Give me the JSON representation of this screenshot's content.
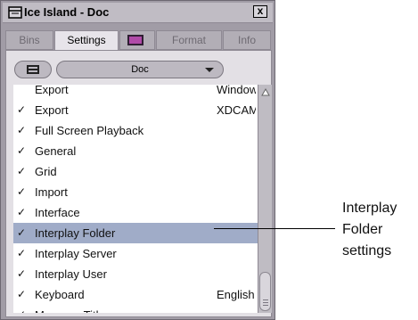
{
  "window": {
    "title": "Ice Island - Doc",
    "close_glyph": "x"
  },
  "tabs": [
    {
      "label": "Bins"
    },
    {
      "label": "Settings"
    },
    {
      "label": ""
    },
    {
      "label": "Format"
    },
    {
      "label": "Info"
    }
  ],
  "toolbar": {
    "selector_value": "Doc"
  },
  "settings_list": [
    {
      "check": "",
      "name": "Export",
      "value": "Window"
    },
    {
      "check": "✓",
      "name": "Export",
      "value": "XDCAM"
    },
    {
      "check": "✓",
      "name": "Full Screen Playback",
      "value": ""
    },
    {
      "check": "✓",
      "name": "General",
      "value": ""
    },
    {
      "check": "✓",
      "name": "Grid",
      "value": ""
    },
    {
      "check": "✓",
      "name": "Import",
      "value": ""
    },
    {
      "check": "✓",
      "name": "Interface",
      "value": ""
    },
    {
      "check": "✓",
      "name": "Interplay Folder",
      "value": ""
    },
    {
      "check": "✓",
      "name": "Interplay Server",
      "value": ""
    },
    {
      "check": "✓",
      "name": "Interplay User",
      "value": ""
    },
    {
      "check": "✓",
      "name": "Keyboard",
      "value": "English"
    },
    {
      "check": "✓",
      "name": "Marquee Title",
      "value": ""
    }
  ],
  "selected_item": "Interplay Folder",
  "callout": {
    "line1": "Interplay",
    "line2": "Folder",
    "line3": "settings"
  },
  "icons": {
    "window_icon": "bin-window-icon",
    "tab_swatch": "color-swatch-icon",
    "toolbar": "bin-view-icon"
  },
  "colors": {
    "selected_row": "#a0acc8",
    "swatch": "#b04aa8"
  }
}
